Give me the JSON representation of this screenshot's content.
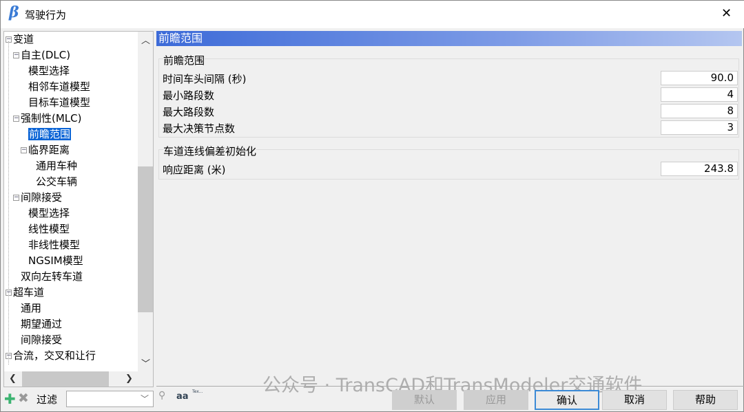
{
  "window": {
    "logo": "β",
    "title": "驾驶行为",
    "close": "✕"
  },
  "tree": {
    "items": [
      {
        "label": "变道",
        "level": 0,
        "expander": true
      },
      {
        "label": "自主(DLC)",
        "level": 1,
        "expander": true
      },
      {
        "label": "模型选择",
        "level": 2
      },
      {
        "label": "相邻车道模型",
        "level": 2
      },
      {
        "label": "目标车道模型",
        "level": 2
      },
      {
        "label": "强制性(MLC)",
        "level": 1,
        "expander": true
      },
      {
        "label": "前瞻范围",
        "level": 2,
        "selected": true
      },
      {
        "label": "临界距离",
        "level": 2,
        "expander": true
      },
      {
        "label": "通用车种",
        "level": 3
      },
      {
        "label": "公交车辆",
        "level": 3
      },
      {
        "label": "间隙接受",
        "level": 1,
        "expander": true
      },
      {
        "label": "模型选择",
        "level": 2
      },
      {
        "label": "线性模型",
        "level": 2
      },
      {
        "label": "非线性模型",
        "level": 2
      },
      {
        "label": "NGSIM模型",
        "level": 2
      },
      {
        "label": "双向左转车道",
        "level": 1
      },
      {
        "label": "超车道",
        "level": 0,
        "expander": true
      },
      {
        "label": "通用",
        "level": 1
      },
      {
        "label": "期望通过",
        "level": 1
      },
      {
        "label": "间隙接受",
        "level": 1
      },
      {
        "label": "合流，交叉和让行",
        "level": 0,
        "expander": true
      }
    ]
  },
  "panel": {
    "header": "前瞻范围",
    "groups": [
      {
        "title": "前瞻范围",
        "fields": [
          {
            "label": "时间车头间隔 (秒)",
            "value": "90.0"
          },
          {
            "label": "最小路段数",
            "value": "4"
          },
          {
            "label": "最大路段数",
            "value": "8"
          },
          {
            "label": "最大决策节点数",
            "value": "3"
          }
        ]
      },
      {
        "title": "车道连线偏差初始化",
        "fields": [
          {
            "label": "响应距离 (米)",
            "value": "243.8"
          }
        ]
      }
    ]
  },
  "bottom": {
    "filter_label": "过滤",
    "filter_value": "",
    "aa": "aa",
    "tex": "Tex...",
    "buttons": [
      {
        "label": "默认",
        "enabled": false
      },
      {
        "label": "应用",
        "enabled": false
      },
      {
        "label": "确认",
        "enabled": true,
        "default": true
      },
      {
        "label": "取消",
        "enabled": true
      },
      {
        "label": "帮助",
        "enabled": true
      }
    ]
  },
  "watermark": "公众号 · TransCAD和TransModeler交通软件",
  "colors": {
    "selection": "#0a64d6",
    "header_start": "#3d6bd8",
    "header_end": "#b4c6f0",
    "add": "#3cb371"
  }
}
